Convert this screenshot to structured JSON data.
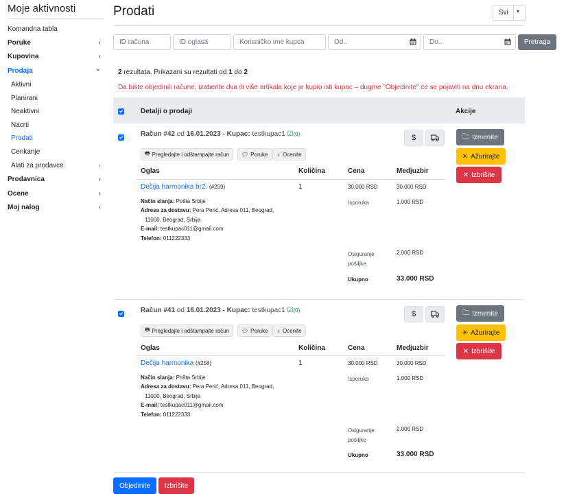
{
  "sidebar": {
    "title": "Moje aktivnosti",
    "items": [
      {
        "label": "Komandna tabla"
      },
      {
        "label": "Poruke",
        "chev": "‹"
      },
      {
        "label": "Kupovina",
        "chev": "‹"
      },
      {
        "label": "Prodaja",
        "chev": "⌄"
      },
      {
        "label": "Aktivni"
      },
      {
        "label": "Planirani"
      },
      {
        "label": "Neaktivni"
      },
      {
        "label": "Nacrti"
      },
      {
        "label": "Prodati"
      },
      {
        "label": "Cenkanje"
      },
      {
        "label": "Alati za prodavce",
        "chev": "‹"
      },
      {
        "label": "Prodavnica",
        "chev": "‹"
      },
      {
        "label": "Ocene",
        "chev": "‹"
      },
      {
        "label": "Moj nalog",
        "chev": "‹"
      }
    ]
  },
  "header": {
    "title": "Prodati",
    "filter_select": "Svi"
  },
  "filters": {
    "invoice_id": "ID računa",
    "ad_id": "ID oglasa",
    "buyer": "Korisničko ime kupca",
    "date_from": "Od..",
    "date_to": "Do..",
    "search_label": "Pretraga"
  },
  "results": {
    "count": "2",
    "text_mid": " rezultata. Prikazani su rezultati od ",
    "from": "1",
    "to_word": " do ",
    "to": "2"
  },
  "notice": "Da biste objedinili račune, izaberite dva ili više artikala koje je kupio isti kupac – dugme \"Objedinite\" će se pojaviti na dnu ekrana.",
  "table": {
    "details": "Detalji o prodaji",
    "actions": "Akcije"
  },
  "inner_headers": {
    "ad": "Oglas",
    "qty": "Količina",
    "price": "Cena",
    "subtotal": "Medjuzbir"
  },
  "labels": {
    "invoice": "Račun #",
    "from": " od ",
    "buyer": "Kupac:",
    "shipping_method": "Način slanja:",
    "address": "Adresa za dostavu:",
    "email": "E-mail:",
    "phone": "Telefon:",
    "delivery": "Isporuka",
    "insurance_1": "Osiguranje",
    "insurance_2": "pošiljke",
    "total": "Ukupno",
    "print": "Pregledajte i odštampajte račun",
    "messages": "Poruke",
    "rate": "Ocenite",
    "edit": "Izmenite",
    "update": "Ažurirajte",
    "delete": "Izbrišite"
  },
  "orders": [
    {
      "number": "42",
      "date": "16.01.2023",
      "buyer": "testkupac1",
      "count": "(0)",
      "item": "Dečija harmonika br2.",
      "item_id": "(#259)",
      "qty": "1",
      "price": "30.000 RSD",
      "subtotal": "30.000 RSD",
      "shipping": "Pošta Srbije",
      "address_1": "Pera Perić, Adresa 011, Beograd,",
      "address_2": "11000, Beograd, Srbija",
      "email": "testkupac011@gmail.com",
      "phone": "011222333",
      "delivery": "1.000 RSD",
      "insurance": "2.000 RSD",
      "total": "33.000 RSD"
    },
    {
      "number": "41",
      "date": "16.01.2023",
      "buyer": "testkupac1",
      "count": "(0)",
      "item": "Dečija harmonika",
      "item_id": "(#258)",
      "qty": "1",
      "price": "30.000 RSD",
      "subtotal": "30.000 RSD",
      "shipping": "Pošta Srbije",
      "address_1": "Pera Perić, Adresa 011, Beograd,",
      "address_2": "11000, Beograd, Srbija",
      "email": "testkupac011@gmail.com",
      "phone": "011222333",
      "delivery": "1.000 RSD",
      "insurance": "2.000 RSD",
      "total": "33.000 RSD"
    }
  ],
  "footer": {
    "merge": "Objedinite",
    "delete": "Izbrišite"
  }
}
